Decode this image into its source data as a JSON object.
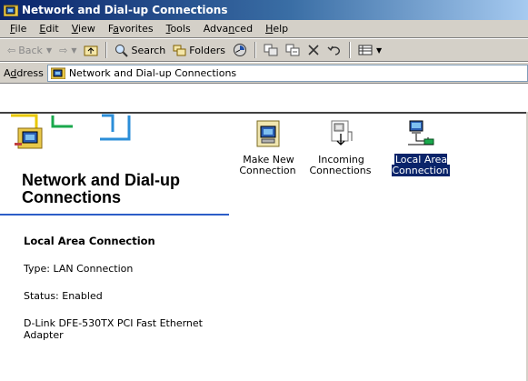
{
  "window": {
    "title": "Network and Dial-up Connections"
  },
  "menu": [
    {
      "pre": "",
      "u": "F",
      "post": "ile"
    },
    {
      "pre": "",
      "u": "E",
      "post": "dit"
    },
    {
      "pre": "",
      "u": "V",
      "post": "iew"
    },
    {
      "pre": "F",
      "u": "a",
      "post": "vorites"
    },
    {
      "pre": "",
      "u": "T",
      "post": "ools"
    },
    {
      "pre": "Adva",
      "u": "n",
      "post": "ced"
    },
    {
      "pre": "",
      "u": "H",
      "post": "elp"
    }
  ],
  "toolbar": {
    "back_label": "Back",
    "search_label": "Search",
    "folders_label": "Folders"
  },
  "address": {
    "label_u": "d",
    "label_pre": "A",
    "label_post": "dress",
    "value": "Network and Dial-up Connections"
  },
  "pane": {
    "title": "Network and Dial-up Connections",
    "selected_name": "Local Area Connection",
    "type_text": "Type: LAN Connection",
    "status_text": "Status: Enabled",
    "device_text": "D-Link DFE-530TX PCI Fast Ethernet Adapter"
  },
  "icons": [
    {
      "label": "Make New Connection",
      "icon": "make-new-connection-icon",
      "selected": false
    },
    {
      "label": "Incoming Connections",
      "icon": "incoming-connections-icon",
      "selected": false
    },
    {
      "label": "Local Area Connection",
      "icon": "local-area-connection-icon",
      "selected": true
    }
  ],
  "colors": {
    "title_start": "#0a246a",
    "title_end": "#a6caf0",
    "selection": "#0a246a",
    "chrome": "#d4d0c8",
    "pane_rule": "#2c5dc8"
  }
}
